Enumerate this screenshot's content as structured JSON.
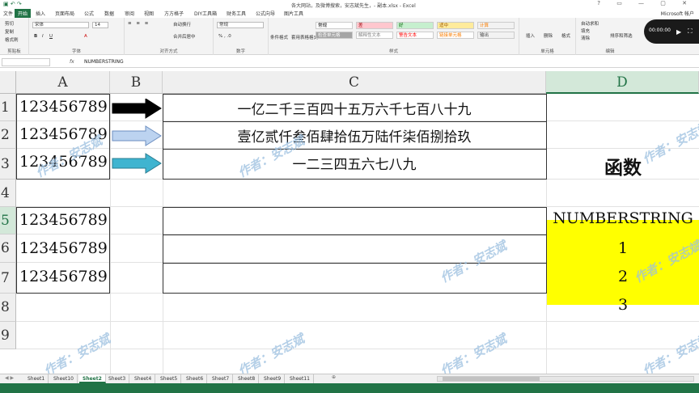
{
  "window": {
    "title": "各大网站，及微博搜索，安志斌先生，- 副本.xlsx - Excel",
    "account": "Microsoft 帐户"
  },
  "menu": {
    "tabs": [
      "文件",
      "开始",
      "插入",
      "页面布局",
      "公式",
      "数据",
      "审阅",
      "视图",
      "方方格子",
      "DIY工具箱",
      "财务工具",
      "公式向导",
      "图片工具"
    ],
    "active_tab": "开始"
  },
  "ribbon": {
    "clipboard": {
      "label": "剪贴板",
      "cut": "剪切",
      "copy": "复制",
      "format_painter": "格式刷"
    },
    "font": {
      "label": "字体",
      "family": "宋体",
      "size": "14"
    },
    "alignment": {
      "label": "对齐方式",
      "wrap": "自动换行",
      "merge": "合并后居中"
    },
    "number": {
      "label": "数字",
      "format": "常规"
    },
    "styles": {
      "label": "样式",
      "conditional": "条件格式",
      "table": "套用表格格式",
      "cells": [
        {
          "name": "常规",
          "bg": "#ffffff",
          "fg": "#000000"
        },
        {
          "name": "差",
          "bg": "#ffc7ce",
          "fg": "#9c0006"
        },
        {
          "name": "好",
          "bg": "#c6efce",
          "fg": "#006100"
        },
        {
          "name": "适中",
          "bg": "#ffeb9c",
          "fg": "#9c5700"
        },
        {
          "name": "计算",
          "bg": "#f2f2f2",
          "fg": "#fa7d00"
        },
        {
          "name": "检查单元格",
          "bg": "#a5a5a5",
          "fg": "#ffffff"
        },
        {
          "name": "解释性文本",
          "bg": "#ffffff",
          "fg": "#7f7f7f"
        },
        {
          "name": "警告文本",
          "bg": "#ffffff",
          "fg": "#ff0000"
        },
        {
          "name": "链接单元格",
          "bg": "#ffffff",
          "fg": "#fa7d00"
        },
        {
          "name": "输出",
          "bg": "#f2f2f2",
          "fg": "#3f3f3f"
        }
      ]
    },
    "cells_group": {
      "label": "单元格",
      "insert": "插入",
      "delete": "删除",
      "format": "格式"
    },
    "editing": {
      "label": "编辑",
      "autosum": "自动求和",
      "fill": "填充",
      "clear": "清除",
      "sort": "排序和筛选",
      "find": "查找和选择"
    }
  },
  "video": {
    "time": "00:00:00"
  },
  "formula_bar": {
    "fx": "fx",
    "content": "NUMBERSTRING"
  },
  "columns": [
    "A",
    "B",
    "C",
    "D"
  ],
  "selected_column": "D",
  "rows": [
    "1",
    "2",
    "3",
    "4",
    "5",
    "6",
    "7",
    "8",
    "9"
  ],
  "selected_row": "5",
  "cells": {
    "A1": "123456789",
    "A2": "123456789",
    "A3": "123456789",
    "A5": "123456789",
    "A6": "123456789",
    "A7": "123456789",
    "C1": "一亿二千三百四十五万六千七百八十九",
    "C2": "壹亿贰仟叁佰肆拾伍万陆仟柒佰捌拾玖",
    "C3": "一二三四五六七八九",
    "D3": "函数",
    "D5": "NUMBERSTRING",
    "D6": "1",
    "D7": "2",
    "D8": "3"
  },
  "watermark": "作者：安志斌",
  "sheets": [
    "Sheet1",
    "Sheet10",
    "Sheet2",
    "Sheet3",
    "Sheet4",
    "Sheet5",
    "Sheet6",
    "Sheet7",
    "Sheet8",
    "Sheet9",
    "Sheet11"
  ],
  "active_sheet": "Sheet2",
  "colors": {
    "accent": "#217346",
    "highlight": "#ffff00",
    "arrow_black": "#000000",
    "arrow_light": "#bcd3f0",
    "arrow_teal": "#3fb4d0"
  }
}
